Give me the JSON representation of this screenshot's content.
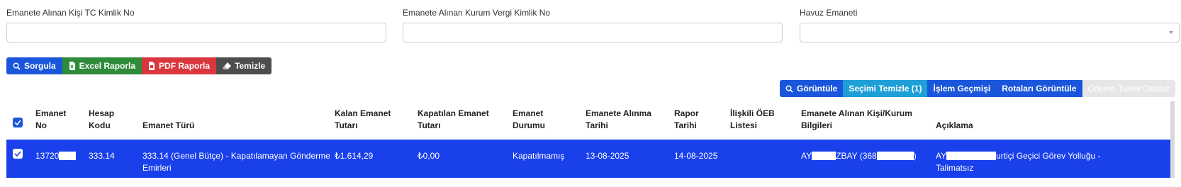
{
  "filters": {
    "tc_label": "Emanete Alınan Kişi TC Kimlik No",
    "tc_value": "",
    "vergi_label": "Emanete Alınan Kurum Vergi Kimlik No",
    "vergi_value": "",
    "havuz_label": "Havuz Emaneti",
    "havuz_value": ""
  },
  "toolbar": {
    "sorgula": "Sorgula",
    "excel": "Excel Raporla",
    "pdf": "PDF Raporla",
    "temizle": "Temizle"
  },
  "actions": {
    "goruntule": "Görüntüle",
    "secimi_temizle": "Seçimi Temizle (1)",
    "islem_gecmisi": "İşlem Geçmişi",
    "rotalari_goruntule": "Rotaları Görüntüle",
    "odeme_talebi": "Ödeme Talebi Oluştur"
  },
  "table": {
    "headers": {
      "emanet_no": [
        "Emanet",
        "No"
      ],
      "hesap_kodu": [
        "Hesap",
        "Kodu"
      ],
      "emanet_turu": "Emanet Türü",
      "kalan_tutar": [
        "Kalan Emanet",
        "Tutarı"
      ],
      "kapatilan_tutar": [
        "Kapatılan Emanet",
        "Tutarı"
      ],
      "durum": [
        "Emanet",
        "Durumu"
      ],
      "alinma_tarihi": [
        "Emanete Alınma",
        "Tarihi"
      ],
      "rapor_tarihi": [
        "Rapor",
        "Tarihi"
      ],
      "oeb_listesi": [
        "İlişkili ÖEB",
        "Listesi"
      ],
      "kisi_kurum": [
        "Emanete Alınan Kişi/Kurum",
        "Bilgileri"
      ],
      "aciklama": "Açıklama"
    },
    "rows": [
      {
        "emanet_no": "13720",
        "hesap_kodu": "333.14",
        "emanet_turu_1": "333.14 (Genel Bütçe) - Kapatılamayan Gönderme",
        "emanet_turu_2": "Emirleri",
        "kalan_tutar": "₺1.614,29",
        "kapatilan_tutar": "₺0,00",
        "durum": "Kapatılmamış",
        "alinma_tarihi": "13-08-2025",
        "rapor_tarihi": "14-08-2025",
        "oeb_listesi": "",
        "kisi_kurum_a": "AY",
        "kisi_kurum_b": "ZBAY (368",
        "kisi_kurum_c": ")",
        "aciklama_a": "AY",
        "aciklama_b": "urtiçi Geçici Görev Yolluğu -",
        "aciklama_2": "Talimatsız"
      }
    ]
  },
  "colors": {
    "primary": "#1a56db",
    "selected_row": "#1a40ec",
    "success": "#2e8b3a",
    "danger": "#d9363e",
    "dark": "#4d4d4d",
    "info": "#1e9fd8"
  }
}
